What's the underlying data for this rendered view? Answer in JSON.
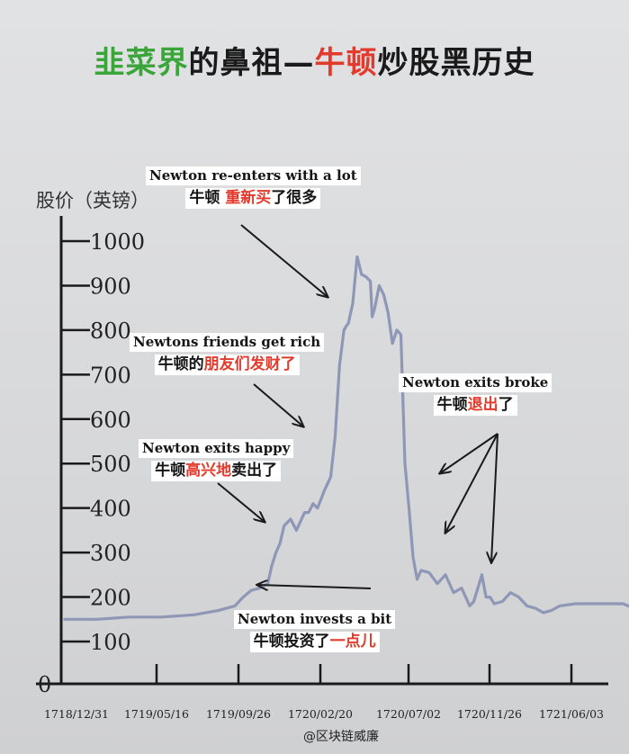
{
  "title": {
    "part1": "韭菜界",
    "part2": "的鼻祖—",
    "part3": "牛顿",
    "part4": "炒股黑历史"
  },
  "colors": {
    "green": "#3aa63a",
    "red": "#e23a2c",
    "line": "#8f97b6",
    "axis": "#1a1a1a"
  },
  "annotations": [
    {
      "en": "Newton re-enters with a lot",
      "zh_pre": "牛顿 ",
      "zh_hl": "重新买",
      "zh_post": "了很多"
    },
    {
      "en": "Newtons friends get rich",
      "zh_pre": "牛顿的",
      "zh_hl": "朋友们发财了",
      "zh_post": ""
    },
    {
      "en": "Newton exits happy",
      "zh_pre": "牛顿",
      "zh_hl": "高兴地",
      "zh_post": "卖出了"
    },
    {
      "en": "Newton exits broke",
      "zh_pre": "牛顿",
      "zh_hl": "退出",
      "zh_post": "了"
    },
    {
      "en": "Newton invests a bit",
      "zh_pre": "牛顿投资了",
      "zh_hl": "一点儿",
      "zh_post": ""
    }
  ],
  "watermark": "@区块链威廉",
  "chart_data": {
    "type": "line",
    "ylabel": "股价（英镑）",
    "ylim": [
      0,
      1050
    ],
    "yticks": [
      0,
      100,
      200,
      300,
      400,
      500,
      600,
      700,
      800,
      900,
      1000
    ],
    "xticks": [
      "1718/12/31",
      "1719/05/16",
      "1719/09/26",
      "1720/02/20",
      "1720/07/02",
      "1720/11/26",
      "1721/06/03"
    ],
    "xlim": [
      0,
      7
    ],
    "grid": false,
    "series": [
      {
        "x": [
          0.0,
          0.4,
          0.8,
          1.2,
          1.6,
          1.9,
          2.1,
          2.2,
          2.3,
          2.4,
          2.5,
          2.55,
          2.6,
          2.65,
          2.7,
          2.78,
          2.85,
          2.9,
          2.95,
          3.0,
          3.05,
          3.1,
          3.18,
          3.25,
          3.3,
          3.35,
          3.4,
          3.43,
          3.45,
          3.5,
          3.55,
          3.6,
          3.65,
          3.7,
          3.72,
          3.75,
          3.8,
          3.85,
          3.9,
          3.95,
          4.0,
          4.05,
          4.1,
          4.15,
          4.2,
          4.25,
          4.3,
          4.4,
          4.5,
          4.6,
          4.7,
          4.8,
          4.9,
          4.95,
          5.0,
          5.05,
          5.1,
          5.15,
          5.2,
          5.3,
          5.4,
          5.5,
          5.6,
          5.7,
          5.8,
          5.9,
          6.0,
          6.2,
          6.4,
          6.6,
          6.8,
          7.0
        ],
        "y": [
          150,
          150,
          155,
          155,
          160,
          170,
          180,
          200,
          215,
          220,
          230,
          270,
          300,
          320,
          360,
          375,
          350,
          370,
          390,
          390,
          410,
          400,
          440,
          470,
          560,
          720,
          800,
          810,
          815,
          860,
          965,
          925,
          920,
          910,
          830,
          850,
          900,
          880,
          840,
          770,
          800,
          790,
          500,
          400,
          290,
          240,
          260,
          255,
          230,
          250,
          210,
          220,
          180,
          190,
          220,
          250,
          200,
          200,
          185,
          190,
          210,
          200,
          180,
          175,
          165,
          170,
          180,
          185,
          185,
          185,
          185,
          170
        ]
      }
    ]
  }
}
